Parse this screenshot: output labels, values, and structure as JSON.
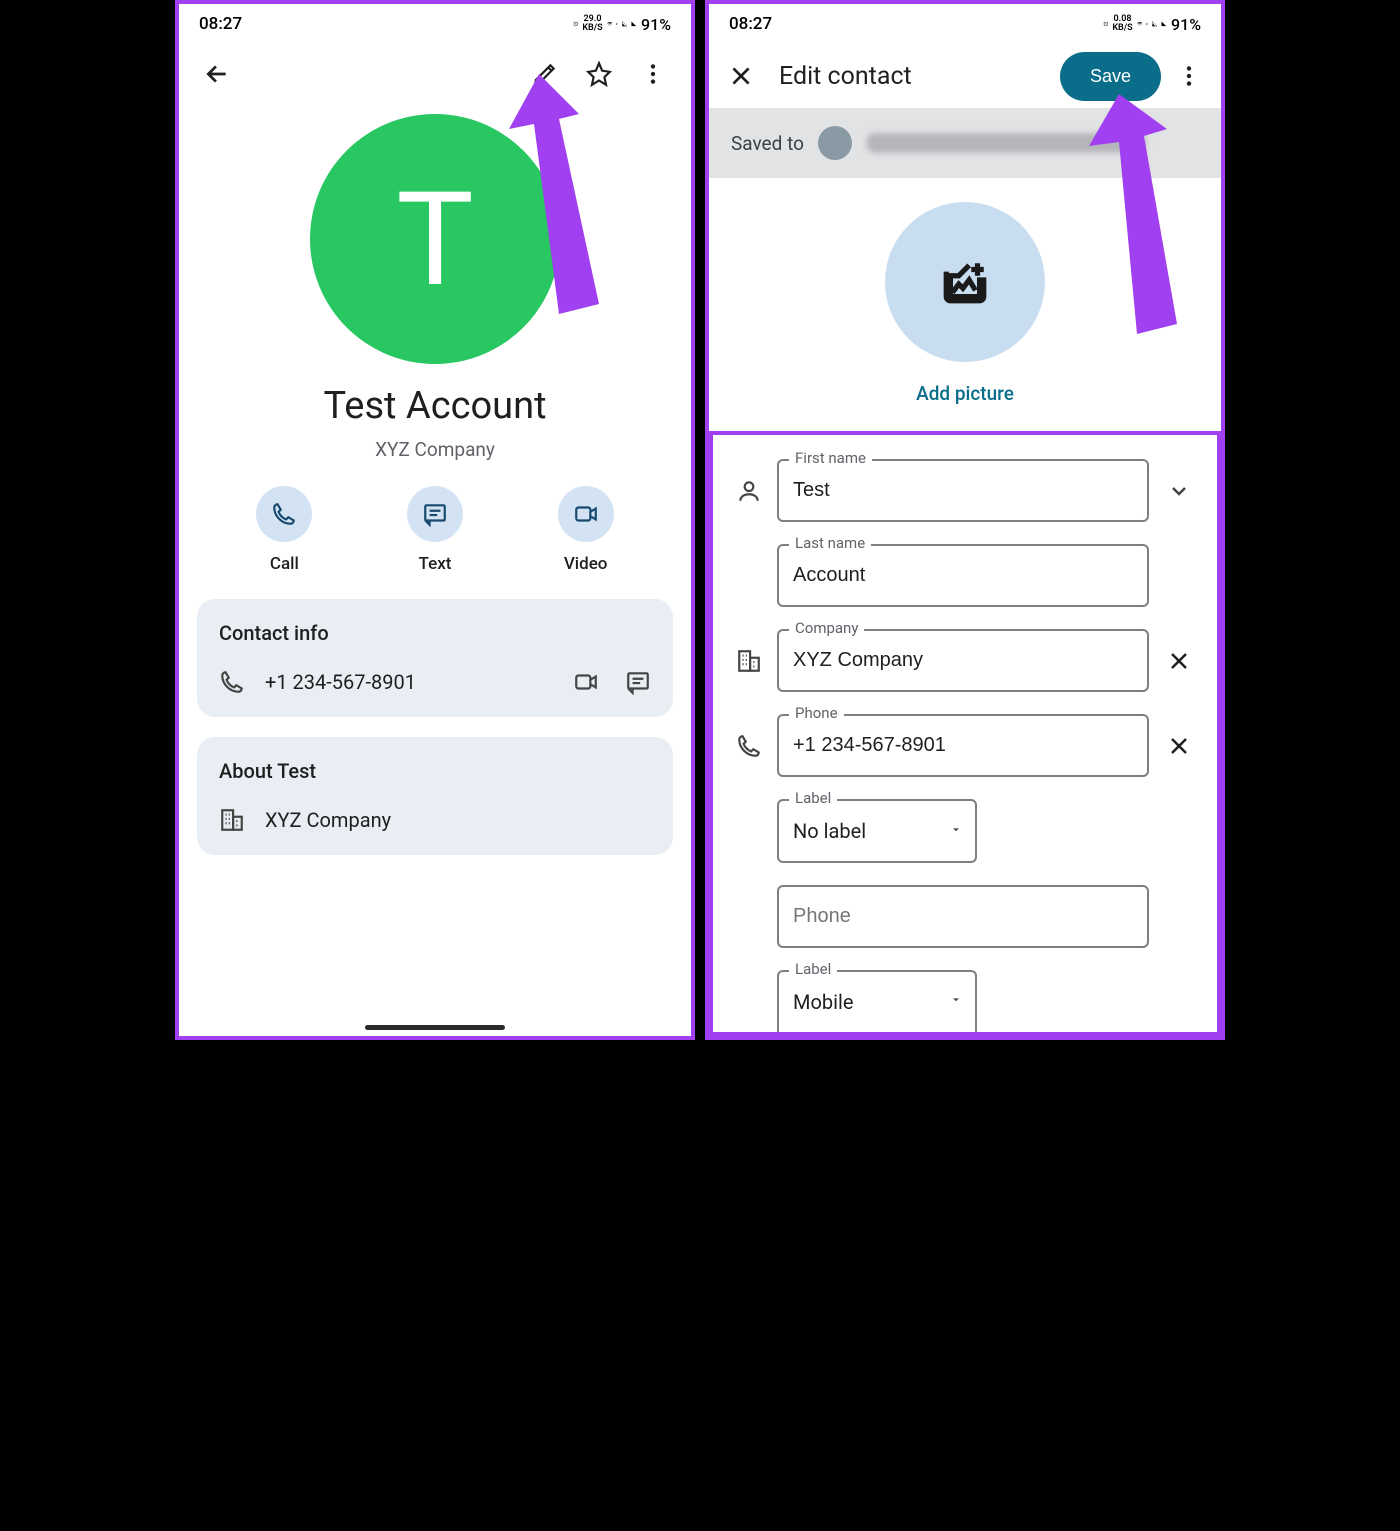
{
  "statusbar": {
    "time": "08:27",
    "net_speed_left": "29.0",
    "net_unit_left": "KB/S",
    "net_speed_right": "0.08",
    "net_unit_right": "KB/S",
    "battery": "91%"
  },
  "left": {
    "avatar_initial": "T",
    "name": "Test Account",
    "company": "XYZ Company",
    "actions": {
      "call": "Call",
      "text": "Text",
      "video": "Video"
    },
    "contact_info": {
      "title": "Contact info",
      "phone": "+1 234-567-8901"
    },
    "about": {
      "title": "About Test",
      "company": "XYZ Company"
    }
  },
  "right": {
    "title": "Edit contact",
    "save": "Save",
    "saved_to": "Saved to",
    "add_picture": "Add picture",
    "fields": {
      "first_name_label": "First name",
      "first_name": "Test",
      "last_name_label": "Last name",
      "last_name": "Account",
      "company_label": "Company",
      "company": "XYZ Company",
      "phone_label": "Phone",
      "phone": "+1 234-567-8901",
      "label1_label": "Label",
      "label1": "No label",
      "phone2_placeholder": "Phone",
      "label2_label": "Label",
      "label2": "Mobile"
    }
  }
}
